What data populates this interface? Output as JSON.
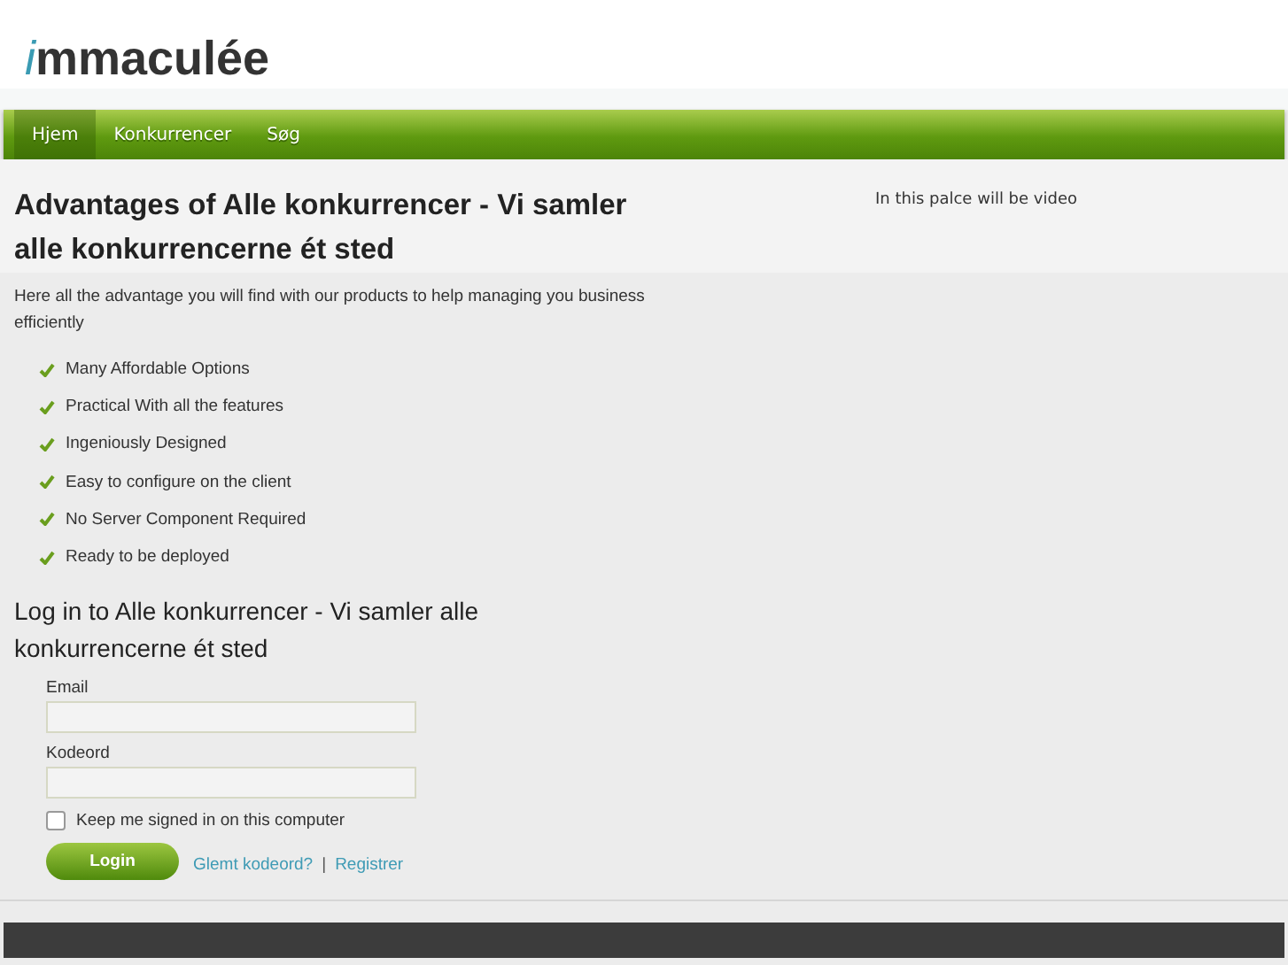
{
  "logo": {
    "mark": "i",
    "text": "mmaculée"
  },
  "nav": [
    {
      "label": "Hjem",
      "selected": true
    },
    {
      "label": "Konkurrencer",
      "selected": false
    },
    {
      "label": "Søg",
      "selected": false
    }
  ],
  "heading": "Advantages of Alle konkurrencer - Vi samler alle konkurrencerne ét sted",
  "intro": "Here all the advantage you will find with our products to help managing you business efficiently",
  "advantages": [
    "Many Affordable Options",
    "Practical With all the features",
    "Ingeniously Designed",
    "Easy to configure on the client",
    "No Server Component Required",
    "Ready to be deployed"
  ],
  "video_note": "In this palce will be video",
  "login": {
    "heading": "Log in to Alle konkurrencer - Vi samler alle konkurrencerne ét sted",
    "fields": [
      {
        "label": "Email"
      },
      {
        "label": "Kodeord"
      }
    ],
    "remember": {
      "label": "Keep me signed in on this computer",
      "checked": false
    },
    "button": "Login",
    "links": [
      "Glemt kodeord?",
      "Registrer"
    ],
    "separator": "|"
  }
}
